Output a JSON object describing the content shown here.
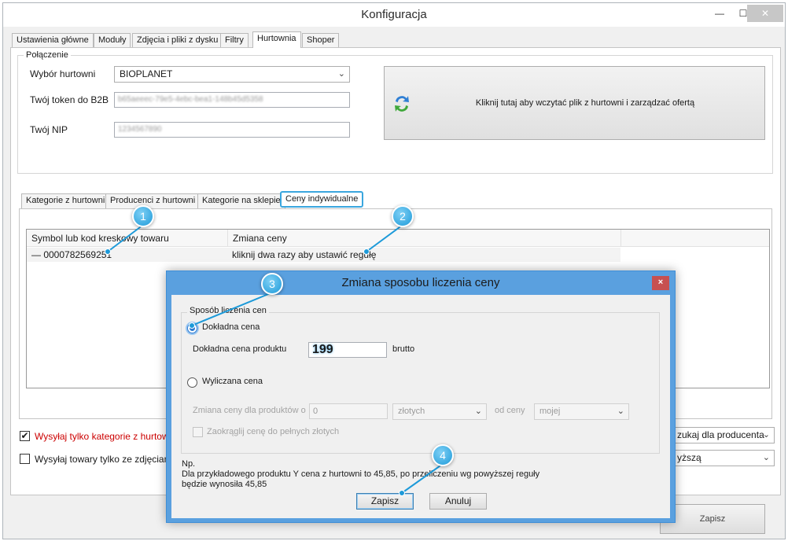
{
  "window": {
    "title": "Konfiguracja",
    "minimize": "—",
    "maximize": "☐",
    "close": "✕"
  },
  "main_tabs": [
    "Ustawienia główne",
    "Moduły",
    "Zdjęcia i pliki z dysku",
    "Filtry",
    "Hurtownia",
    "Shoper"
  ],
  "connection": {
    "group_title": "Połączenie",
    "wholesaler_label": "Wybór hurtowni",
    "wholesaler_value": "BIOPLANET",
    "token_label": "Twój token do B2B",
    "token_value": "b65aeeec-79e5-4ebc-bea1-148b45d5358",
    "nip_label": "Twój NIP",
    "nip_value": "1234567890",
    "load_button_label": "Kliknij tutaj aby wczytać plik z hurtowni i zarządzać ofertą"
  },
  "sub_tabs": [
    "Kategorie z hurtowni",
    "Producenci z hurtowni",
    "Kategorie na sklepie",
    "Ceny indywidualne"
  ],
  "grid": {
    "headers": [
      "Symbol lub kod kreskowy towaru",
      "Zmiana ceny"
    ],
    "rows": [
      {
        "symbol": "— 0000782569251",
        "change": "kliknij dwa razy aby ustawić regułę"
      }
    ]
  },
  "options": {
    "only_wholesale_categories": "Wysyłaj tylko kategorie z hurtowni, k",
    "only_with_photos": "Wysyłaj towary tylko ze zdjęciami",
    "producer_combo": "zukaj dla producenta",
    "higher_combo": "yższą"
  },
  "main_save": "Zapisz",
  "dialog": {
    "title": "Zmiana sposobu liczenia ceny",
    "close": "×",
    "group_title": "Sposób liczenia cen",
    "exact_price_radio": "Dokładna cena",
    "exact_price_label": "Dokładna cena produktu",
    "exact_price_value": "199",
    "brutto": "brutto",
    "calculated_price_radio": "Wyliczana cena",
    "change_for_products_label": "Zmiana ceny dla produktów o",
    "change_amount_value": "0",
    "currency_option": "złotych",
    "from_price_label": "od ceny",
    "price_source_option": "mojej",
    "round_checkbox": "Zaokrąglij cenę do pełnych złotych",
    "example_title": "Np.",
    "example_line1": "Dla przykładowego produktu Y cena z hurtowni to 45,85, po przeliczeniu wg powyższej reguły",
    "example_line2": "będzie wynosiła 45,85",
    "save_button": "Zapisz",
    "cancel_button": "Anuluj"
  },
  "callouts": [
    "1",
    "2",
    "3",
    "4"
  ],
  "colors": {
    "accent_blue": "#1d9ad9",
    "dialog_frame": "#5aa0df",
    "warning_text": "#cc0000"
  }
}
